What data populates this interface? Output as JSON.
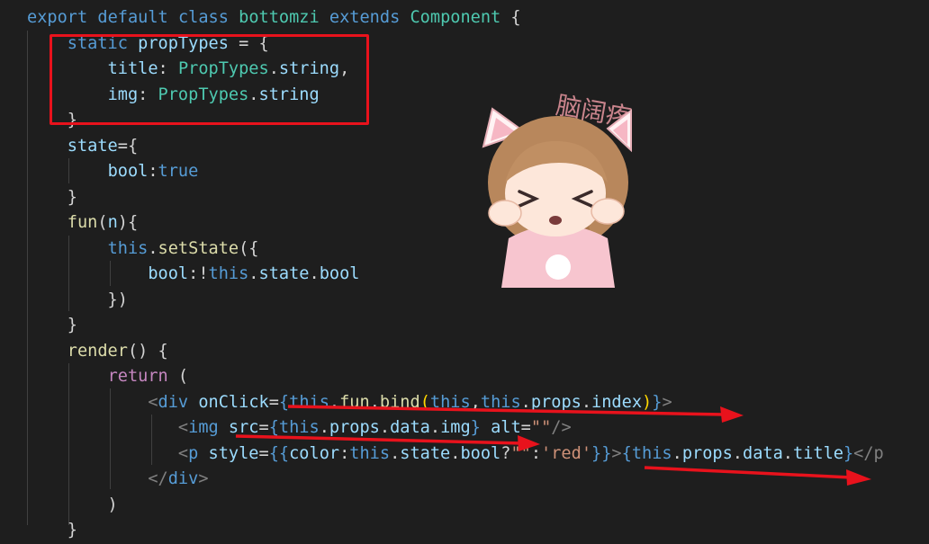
{
  "code_lines": [
    [
      [
        "kw",
        "export"
      ],
      [
        "pun",
        " "
      ],
      [
        "kw",
        "default"
      ],
      [
        "pun",
        " "
      ],
      [
        "kw",
        "class"
      ],
      [
        "pun",
        " "
      ],
      [
        "cls",
        "bottomzi"
      ],
      [
        "pun",
        " "
      ],
      [
        "kw",
        "extends"
      ],
      [
        "pun",
        " "
      ],
      [
        "cls",
        "Component"
      ],
      [
        "pun",
        " {"
      ]
    ],
    [
      [
        "pun",
        "    "
      ],
      [
        "kw",
        "static"
      ],
      [
        "pun",
        " "
      ],
      [
        "var",
        "propTypes"
      ],
      [
        "pun",
        " = {"
      ]
    ],
    [
      [
        "pun",
        "        "
      ],
      [
        "var",
        "title"
      ],
      [
        "pun",
        ": "
      ],
      [
        "cls",
        "PropTypes"
      ],
      [
        "pun",
        "."
      ],
      [
        "var",
        "string"
      ],
      [
        "pun",
        ","
      ]
    ],
    [
      [
        "pun",
        "        "
      ],
      [
        "var",
        "img"
      ],
      [
        "pun",
        ": "
      ],
      [
        "cls",
        "PropTypes"
      ],
      [
        "pun",
        "."
      ],
      [
        "var",
        "string"
      ]
    ],
    [
      [
        "pun",
        "    }"
      ]
    ],
    [
      [
        "pun",
        "    "
      ],
      [
        "var",
        "state"
      ],
      [
        "pun",
        "={"
      ]
    ],
    [
      [
        "pun",
        "        "
      ],
      [
        "var",
        "bool"
      ],
      [
        "pun",
        ":"
      ],
      [
        "kw",
        "true"
      ]
    ],
    [
      [
        "pun",
        "    }"
      ]
    ],
    [
      [
        "pun",
        "    "
      ],
      [
        "fn",
        "fun"
      ],
      [
        "pun",
        "("
      ],
      [
        "var",
        "n"
      ],
      [
        "pun",
        "){"
      ]
    ],
    [
      [
        "pun",
        "        "
      ],
      [
        "kw",
        "this"
      ],
      [
        "pun",
        "."
      ],
      [
        "fn",
        "setState"
      ],
      [
        "pun",
        "({"
      ]
    ],
    [
      [
        "pun",
        "            "
      ],
      [
        "var",
        "bool"
      ],
      [
        "pun",
        ":!"
      ],
      [
        "kw",
        "this"
      ],
      [
        "pun",
        "."
      ],
      [
        "var",
        "state"
      ],
      [
        "pun",
        "."
      ],
      [
        "var",
        "bool"
      ]
    ],
    [
      [
        "pun",
        "        })"
      ]
    ],
    [
      [
        "pun",
        "    }"
      ]
    ],
    [
      [
        "pun",
        "    "
      ],
      [
        "fn",
        "render"
      ],
      [
        "pun",
        "() {"
      ]
    ],
    [
      [
        "pun",
        "        "
      ],
      [
        "ctl",
        "return"
      ],
      [
        "pun",
        " ("
      ]
    ],
    [
      [
        "pun",
        "            "
      ],
      [
        "tag",
        "<"
      ],
      [
        "tagname",
        "div"
      ],
      [
        "pun",
        " "
      ],
      [
        "attr",
        "onClick"
      ],
      [
        "pun",
        "="
      ],
      [
        "brace",
        "{"
      ],
      [
        "kw",
        "this"
      ],
      [
        "pun",
        "."
      ],
      [
        "fn",
        "fun"
      ],
      [
        "pun",
        "."
      ],
      [
        "fn",
        "bind"
      ],
      [
        "paren",
        "("
      ],
      [
        "kw",
        "this"
      ],
      [
        "pun",
        ","
      ],
      [
        "kw",
        "this"
      ],
      [
        "pun",
        "."
      ],
      [
        "var",
        "props"
      ],
      [
        "pun",
        "."
      ],
      [
        "var",
        "index"
      ],
      [
        "paren",
        ")"
      ],
      [
        "brace",
        "}"
      ],
      [
        "tag",
        ">"
      ]
    ],
    [
      [
        "pun",
        "               "
      ],
      [
        "tag",
        "<"
      ],
      [
        "tagname",
        "img"
      ],
      [
        "pun",
        " "
      ],
      [
        "attr",
        "src"
      ],
      [
        "pun",
        "="
      ],
      [
        "brace",
        "{"
      ],
      [
        "kw",
        "this"
      ],
      [
        "pun",
        "."
      ],
      [
        "var",
        "props"
      ],
      [
        "pun",
        "."
      ],
      [
        "var",
        "data"
      ],
      [
        "pun",
        "."
      ],
      [
        "var",
        "img"
      ],
      [
        "brace",
        "}"
      ],
      [
        "pun",
        " "
      ],
      [
        "attr",
        "alt"
      ],
      [
        "pun",
        "="
      ],
      [
        "str",
        "\"\""
      ],
      [
        "tag",
        "/>"
      ]
    ],
    [
      [
        "pun",
        "               "
      ],
      [
        "tag",
        "<"
      ],
      [
        "tagname",
        "p"
      ],
      [
        "pun",
        " "
      ],
      [
        "attr",
        "style"
      ],
      [
        "pun",
        "="
      ],
      [
        "brace",
        "{{"
      ],
      [
        "var",
        "color"
      ],
      [
        "pun",
        ":"
      ],
      [
        "kw",
        "this"
      ],
      [
        "pun",
        "."
      ],
      [
        "var",
        "state"
      ],
      [
        "pun",
        "."
      ],
      [
        "var",
        "bool"
      ],
      [
        "pun",
        "?"
      ],
      [
        "str",
        "\"\""
      ],
      [
        "pun",
        ":"
      ],
      [
        "str",
        "'red'"
      ],
      [
        "brace",
        "}}"
      ],
      [
        "tag",
        ">"
      ],
      [
        "brace",
        "{"
      ],
      [
        "kw",
        "this"
      ],
      [
        "pun",
        "."
      ],
      [
        "var",
        "props"
      ],
      [
        "pun",
        "."
      ],
      [
        "var",
        "data"
      ],
      [
        "pun",
        "."
      ],
      [
        "var",
        "title"
      ],
      [
        "brace",
        "}"
      ],
      [
        "tag",
        "</p"
      ]
    ],
    [
      [
        "pun",
        "            "
      ],
      [
        "tag",
        "</"
      ],
      [
        "tagname",
        "div"
      ],
      [
        "tag",
        ">"
      ]
    ],
    [
      [
        "pun",
        "        )"
      ]
    ],
    [
      [
        "pun",
        "    }"
      ]
    ]
  ],
  "sticker": {
    "caption": "脑阔疼",
    "colors": {
      "hair": "#b8875c",
      "skin": "#fde7da",
      "outfit": "#f7c5cf",
      "ear_inner": "#f6b7c4"
    }
  },
  "annotation_color": "#e8121c"
}
